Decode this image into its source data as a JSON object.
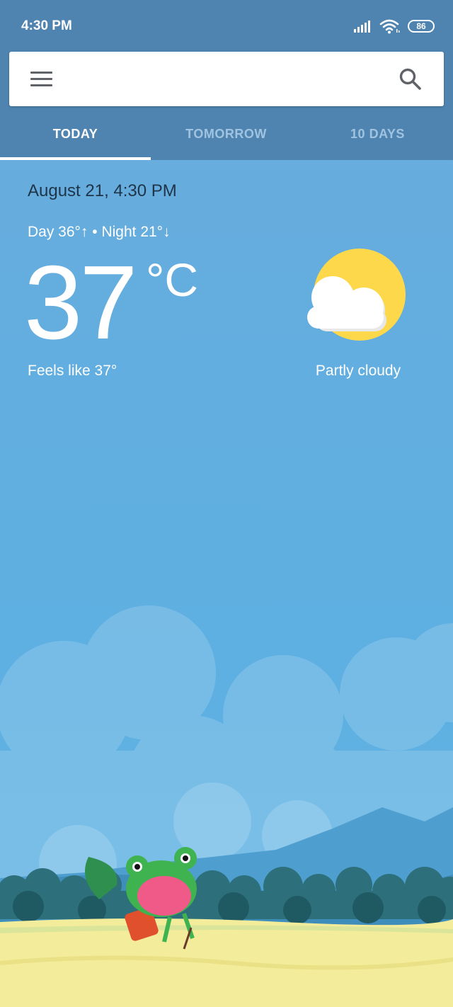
{
  "status_bar": {
    "time": "4:30 PM",
    "battery": "86",
    "icons": [
      "signal-icon",
      "wifi-icon",
      "battery-icon"
    ]
  },
  "search": {
    "value": "",
    "icons": [
      "menu-icon",
      "search-icon"
    ]
  },
  "tabs": [
    {
      "label": "TODAY",
      "active": true
    },
    {
      "label": "TOMORROW",
      "active": false
    },
    {
      "label": "10 DAYS",
      "active": false
    }
  ],
  "weather": {
    "date_time": "August 21, 4:30 PM",
    "day_night": "Day 36°↑ • Night 21°↓",
    "temperature": "37",
    "unit": "°C",
    "feels_like": "Feels like 37°",
    "condition": "Partly cloudy",
    "icon": "partly-cloudy-icon"
  },
  "colors": {
    "header": "#4f84b0",
    "sky": "#62aee0",
    "sun": "#fdd84a",
    "grass": "#f3ec9a",
    "date_text": "#1f3448"
  }
}
